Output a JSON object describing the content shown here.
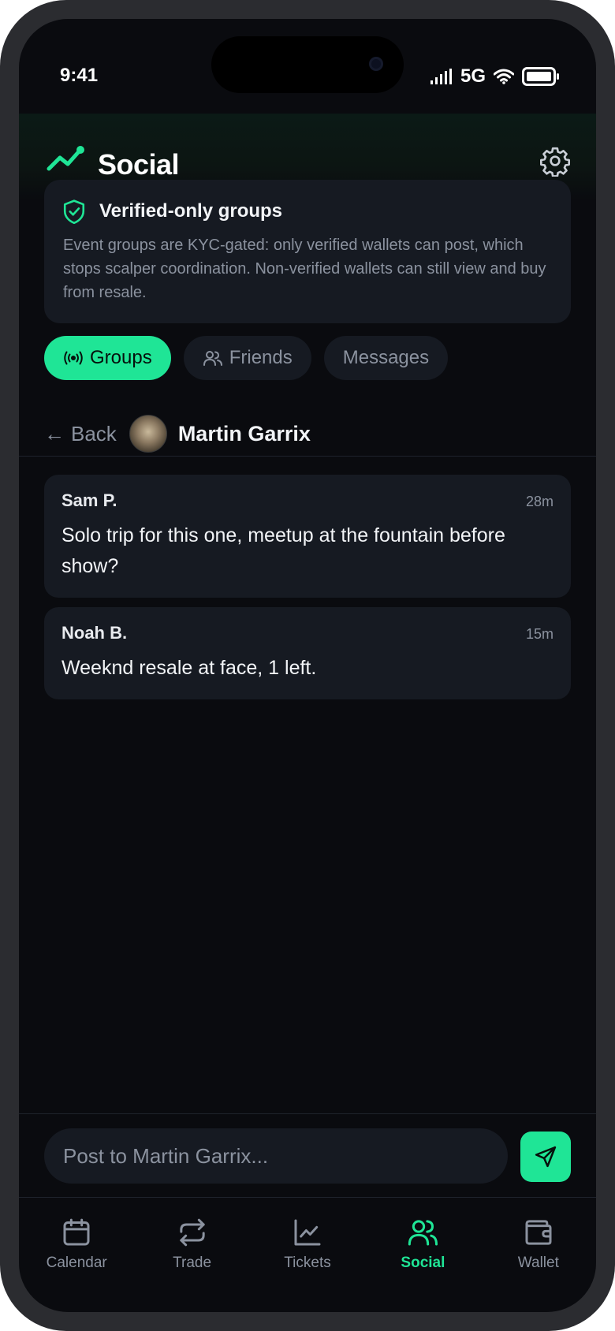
{
  "status_bar": {
    "time": "9:41",
    "network": "5G"
  },
  "header": {
    "title": "Social"
  },
  "info_card": {
    "title": "Verified-only groups",
    "text": "Event groups are KYC-gated: only verified wallets can post, which stops scalper coordination. Non-verified wallets can still view and buy from resale."
  },
  "tabs": [
    {
      "label": "Groups",
      "icon": "broadcast-icon",
      "active": true
    },
    {
      "label": "Friends",
      "icon": "users-icon",
      "active": false
    },
    {
      "label": "Messages",
      "icon": "",
      "active": false
    }
  ],
  "chat": {
    "back_label": "Back",
    "name": "Martin Garrix"
  },
  "messages": [
    {
      "author": "Sam P.",
      "time": "28m",
      "text": "Solo trip for this one, meetup at the fountain before show?"
    },
    {
      "author": "Noah B.",
      "time": "15m",
      "text": "Weeknd resale at face, 1 left."
    }
  ],
  "compose": {
    "placeholder": "Post to Martin Garrix..."
  },
  "nav": [
    {
      "label": "Calendar",
      "icon": "calendar-icon"
    },
    {
      "label": "Trade",
      "icon": "repeat-icon"
    },
    {
      "label": "Tickets",
      "icon": "chart-line-icon"
    },
    {
      "label": "Social",
      "icon": "users-icon",
      "active": true
    },
    {
      "label": "Wallet",
      "icon": "wallet-icon"
    }
  ],
  "colors": {
    "accent": "#1fe596",
    "background": "#0a0b0f",
    "card": "#161a22",
    "muted": "#8b929f"
  }
}
